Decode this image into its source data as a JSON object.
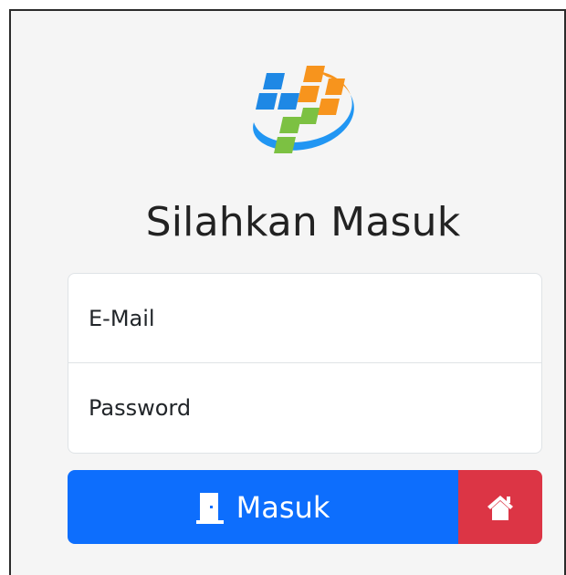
{
  "page": {
    "title": "Silahkan Masuk"
  },
  "form": {
    "email_placeholder": "E-Mail",
    "password_placeholder": "Password"
  },
  "buttons": {
    "login_label": "Masuk",
    "home_icon": "home-icon"
  },
  "icons": {
    "logo": "bps-logo",
    "door": "door-icon"
  },
  "colors": {
    "primary": "#0d6efd",
    "danger": "#dc3545",
    "background": "#f5f5f5",
    "logo_blue": "#1e88e5",
    "logo_orange": "#f7941d",
    "logo_green": "#7cc142"
  }
}
